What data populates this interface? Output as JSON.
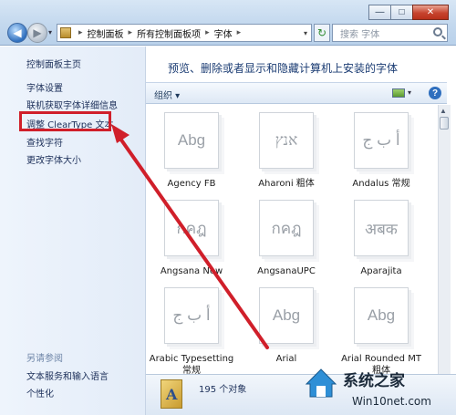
{
  "window": {
    "minimize_glyph": "—",
    "maximize_glyph": "□",
    "close_glyph": "✕"
  },
  "nav": {
    "back_glyph": "◀",
    "forward_glyph": "▶",
    "dropdown_glyph": "▾"
  },
  "address": {
    "breadcrumbs": [
      "控制面板",
      "所有控制面板项",
      "字体"
    ],
    "separator": "▸",
    "dropdown_glyph": "▾"
  },
  "refresh_glyph": "↻",
  "search": {
    "placeholder": "搜索 字体"
  },
  "left_pane": {
    "home": "控制面板主页",
    "links": [
      "字体设置",
      "联机获取字体详细信息",
      "调整 ClearType 文本",
      "查找字符",
      "更改字体大小"
    ],
    "see_also_title": "另请参阅",
    "see_also": [
      "文本服务和输入语言",
      "个性化"
    ]
  },
  "main": {
    "title": "预览、删除或者显示和隐藏计算机上安装的字体",
    "organize": "组织 ▾",
    "view_dropdown": "▾",
    "help": "?"
  },
  "fonts": [
    {
      "sample": "Abg",
      "label": "Agency FB"
    },
    {
      "sample": "אנץ",
      "label": "Aharoni 粗体"
    },
    {
      "sample": "أ ب ج",
      "label": "Andalus 常规"
    },
    {
      "sample": "กคฎ",
      "label": "Angsana New"
    },
    {
      "sample": "กคฎ",
      "label": "AngsanaUPC"
    },
    {
      "sample": "अबक",
      "label": "Aparajita"
    },
    {
      "sample": "أ ب ج",
      "label": "Arabic Typesetting 常规"
    },
    {
      "sample": "Abg",
      "label": "Arial"
    },
    {
      "sample": "Abg",
      "label": "Arial Rounded MT 粗体"
    }
  ],
  "status": {
    "count": "195 个对象"
  },
  "watermark": {
    "title": "系统之家",
    "site": "Win10net.com"
  },
  "colors": {
    "highlight": "#d01f2a",
    "arrow": "#d01f2a",
    "link": "#1c2f59"
  }
}
